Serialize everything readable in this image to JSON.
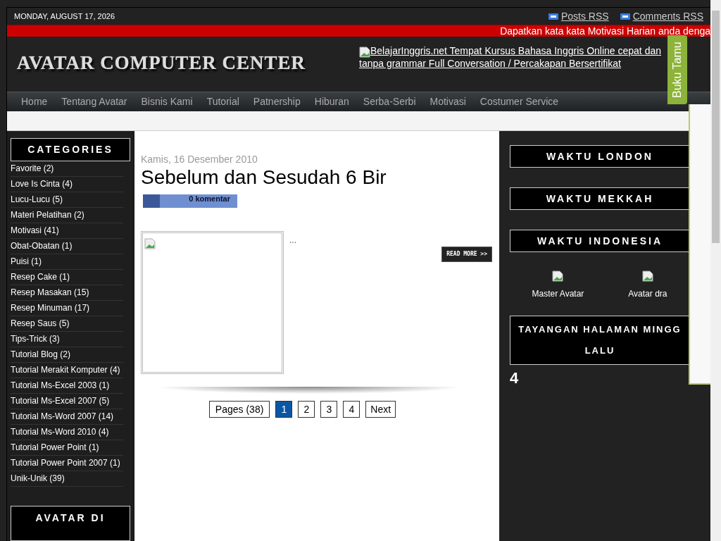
{
  "top_bar": {
    "date": "MONDAY, AUGUST 17, 2026",
    "feeds": [
      "Posts RSS",
      "Comments RSS"
    ]
  },
  "ticker": "Dapatkan kata kata Motivasi Harian anda denga",
  "header": {
    "logo": "AVATAR COMPUTER CENTER",
    "ad_link": "BelajarInggris.net Tempat Kursus Bahasa Inggris Online cepat dan tanpa grammar Full Conversation / Percakapan Bersertifikat"
  },
  "nav": [
    "Home",
    "Tentang Avatar",
    "Bisnis Kami",
    "Tutorial",
    "Patnership",
    "Hiburan",
    "Serba-Serbi",
    "Motivasi",
    "Costumer Service"
  ],
  "categories": {
    "title": "CATEGORIES",
    "items": [
      "Favorite (2)",
      "Love Is Cinta (4)",
      "Lucu-Lucu (5)",
      "Materi Pelatihan (2)",
      "Motivasi (41)",
      "Obat-Obatan (1)",
      "Puisi (1)",
      "Resep Cake (1)",
      "Resep Masakan (15)",
      "Resep Minuman (17)",
      "Resep Saus (5)",
      "Tips-Trick (3)",
      "Tutorial Blog (2)",
      "Tutorial Merakit Komputer (4)",
      "Tutorial Ms-Excel 2003 (1)",
      "Tutorial Ms-Excel 2007 (5)",
      "Tutorial Ms-Word 2007 (14)",
      "Tutorial Ms-Word 2010 (4)",
      "Tutorial Power Point (1)",
      "Tutorial Power Point 2007 (1)",
      "Unik-Unik (39)"
    ]
  },
  "left_widget": {
    "title": "AVATAR DI"
  },
  "post": {
    "date": "Kamis, 16 Desember 2010",
    "title": "Sebelum dan Sesudah 6 Bir",
    "comments": "0 komentar",
    "excerpt": "...",
    "read_more": "READ MORE >>"
  },
  "pagination": [
    {
      "label": "Pages (38)",
      "kind": "info",
      "selected": false
    },
    {
      "label": "1",
      "kind": "page",
      "selected": true
    },
    {
      "label": "2",
      "kind": "page",
      "selected": false
    },
    {
      "label": "3",
      "kind": "page",
      "selected": false
    },
    {
      "label": "4",
      "kind": "page",
      "selected": false
    },
    {
      "label": "Next",
      "kind": "page",
      "selected": false
    }
  ],
  "right_sidebar": {
    "widgets": [
      [
        "WAKTU LONDON"
      ],
      [
        "WAKTU MEKKAH"
      ],
      [
        "WAKTU INDONESIA"
      ]
    ],
    "profiles": [
      "Master Avatar",
      "Avatar dra"
    ],
    "stats_title": [
      "TAYANGAN HALAMAN MINGG",
      "LALU"
    ],
    "stats_value": "4"
  },
  "guestbook_tab": "Buku Tamu"
}
